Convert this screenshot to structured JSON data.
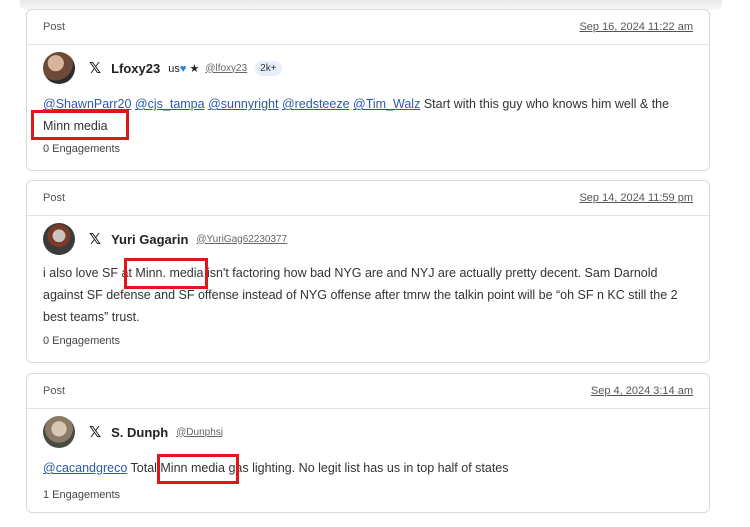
{
  "posts": [
    {
      "label": "Post",
      "date": "Sep 16, 2024 11:22 am",
      "name": "Lfoxy23",
      "flags_text": "us",
      "star": "★",
      "handle": "@lfoxy23",
      "badge": "2k+",
      "mentions": [
        "@ShawnParr20",
        "@cjs_tampa",
        "@sunnyright",
        "@redsteeze",
        "@Tim_Walz"
      ],
      "text": "Start with this guy who knows him well & the Minn media",
      "engagements": "0 Engagements"
    },
    {
      "label": "Post",
      "date": "Sep 14, 2024 11:59 pm",
      "name": "Yuri Gagarin",
      "handle": "@YuriGag62230377",
      "text": "i also love SF at Minn. media isn't factoring how bad NYG are and NYJ are actually pretty decent. Sam Darnold against SF defense and SF offense instead of NYG offense after tmrw the talkin point will be “oh SF n KC still the 2 best teams” trust.",
      "engagements": "0 Engagements"
    },
    {
      "label": "Post",
      "date": "Sep 4, 2024 3:14 am",
      "name": "S. Dunph",
      "handle": "@Dunphsj",
      "mention": "@cacandgreco",
      "text": "Total Minn media gas lighting. No legit list has us in top half of states",
      "engagements": "1 Engagements"
    }
  ],
  "icons": {
    "platform": "x-logo-icon",
    "heart": "blue-heart-icon"
  },
  "colors": {
    "highlight": "#e0161b",
    "mention": "#2b5aa8"
  }
}
